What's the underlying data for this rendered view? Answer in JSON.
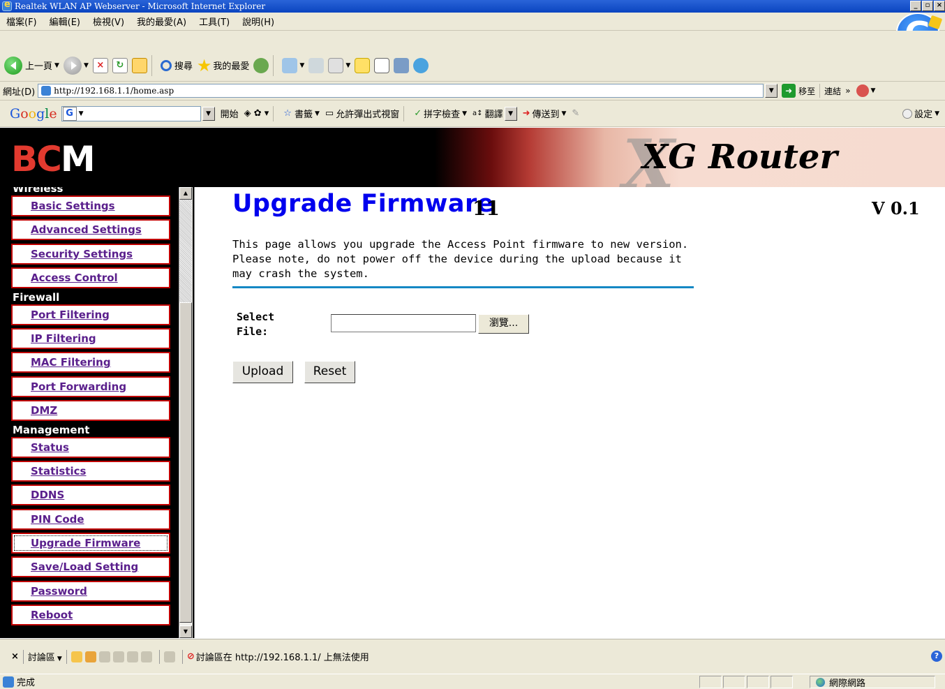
{
  "window": {
    "title": "Realtek WLAN AP Webserver - Microsoft Internet Explorer",
    "buttons": [
      "_",
      "ё",
      "×"
    ]
  },
  "menu": [
    "檔案(F)",
    "編輯(E)",
    "檢視(V)",
    "我的最愛(A)",
    "工具(T)",
    "說明(H)"
  ],
  "toolbar": {
    "back_label": "上一頁",
    "search_label": "搜尋",
    "favorites_label": "我的最愛"
  },
  "address": {
    "label": "網址(D)",
    "url": "http://192.168.1.1/home.asp",
    "go_label": "移至",
    "links_label": "連結",
    "more": "»"
  },
  "googlebar": {
    "logo": [
      "G",
      "o",
      "o",
      "g",
      "l",
      "e"
    ],
    "box_icon": "G",
    "start_label": "開始",
    "bookmarks_label": "書籤",
    "popup_label": "允許彈出式視窗",
    "spell_label": "拼字檢查",
    "translate_label": "翻譯",
    "send_label": "傳送到",
    "settings_label": "設定"
  },
  "banner": {
    "logo_text_a": "B",
    "logo_text_b": "C",
    "logo_text_c": "M",
    "watermark": "X",
    "title": "XG Router"
  },
  "sidebar": {
    "sections": [
      {
        "title": "Wireless",
        "items": [
          {
            "label": "Basic Settings"
          },
          {
            "label": "Advanced Settings"
          },
          {
            "label": "Security Settings"
          },
          {
            "label": "Access Control"
          }
        ]
      },
      {
        "title": "Firewall",
        "items": [
          {
            "label": "Port Filtering"
          },
          {
            "label": "IP Filtering"
          },
          {
            "label": "MAC Filtering"
          },
          {
            "label": "Port Forwarding"
          },
          {
            "label": "DMZ"
          }
        ]
      },
      {
        "title": "Management",
        "items": [
          {
            "label": "Status"
          },
          {
            "label": "Statistics"
          },
          {
            "label": "DDNS"
          },
          {
            "label": "PIN Code"
          },
          {
            "label": "Upgrade Firmware"
          },
          {
            "label": "Save/Load Setting"
          },
          {
            "label": "Password"
          },
          {
            "label": "Reboot"
          }
        ]
      }
    ]
  },
  "main": {
    "heading": "Upgrade Firmware",
    "overlay_glyph": "11",
    "version": "V 0.1",
    "description": "This page allows you upgrade the Access Point firmware to new version. Please note, do not power off the device during the upload because it may crash the system.",
    "file_label_1": "Select",
    "file_label_2": "File:",
    "file_value": "",
    "browse_label": "瀏覽...",
    "upload_label": "Upload",
    "reset_label": "Reset"
  },
  "discuss": {
    "close": "×",
    "label": "討論區",
    "message": "討論區在 http://192.168.1.1/ 上無法使用"
  },
  "status": {
    "text": "完成",
    "zone": "網際網路"
  }
}
